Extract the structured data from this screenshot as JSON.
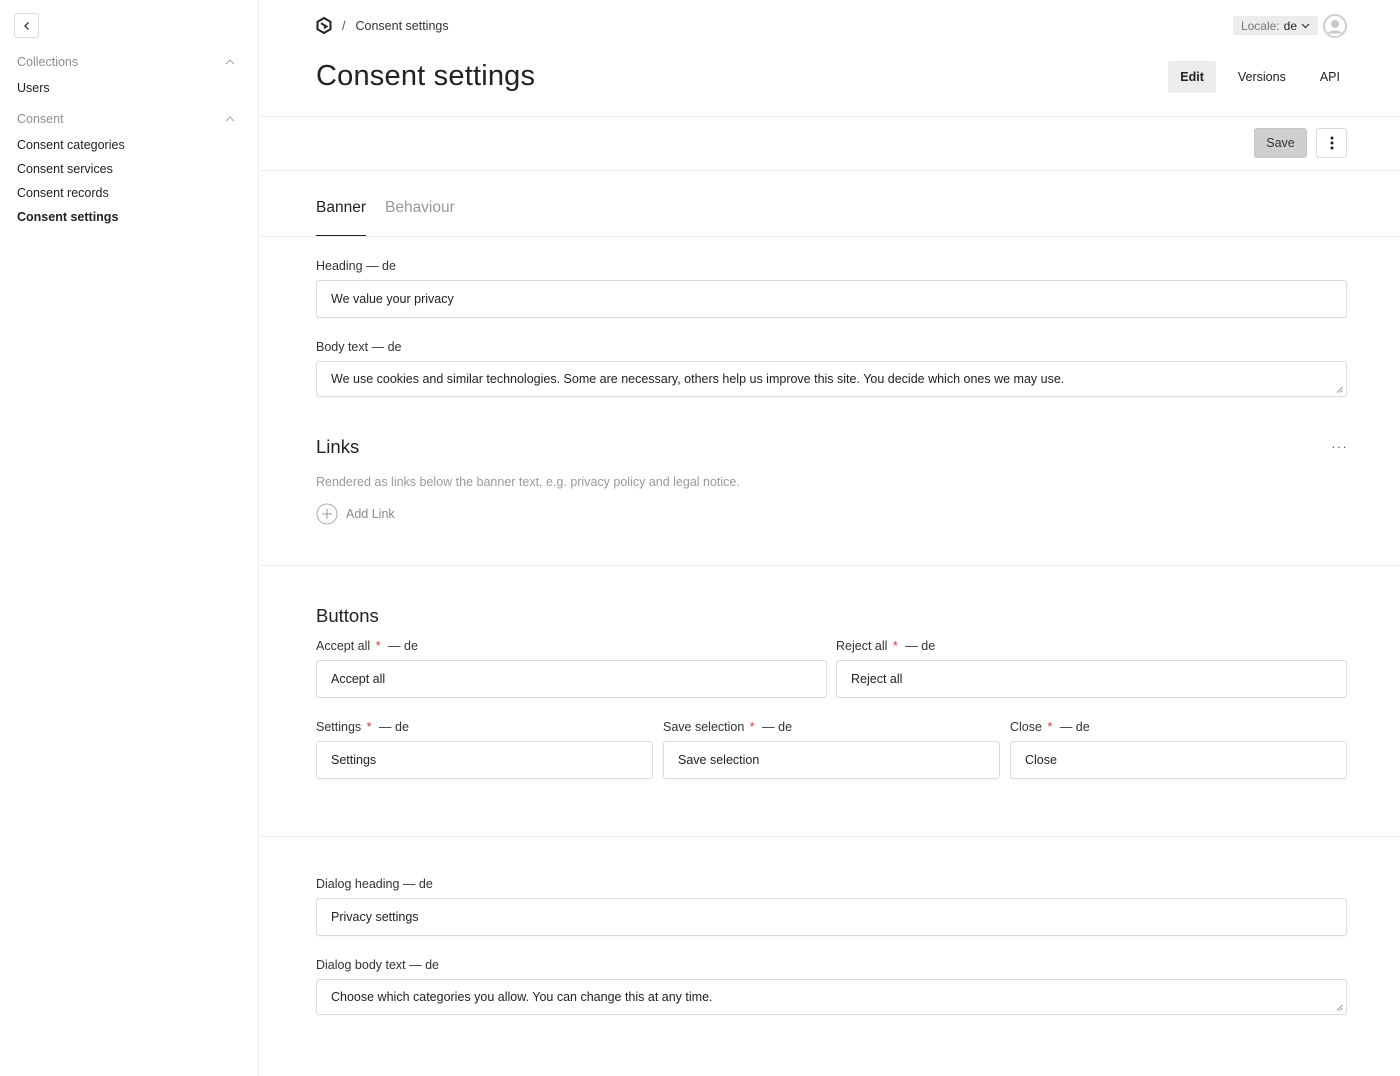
{
  "sidebar": {
    "collapse_icon": "chevron-left-icon",
    "groups": [
      {
        "title": "Collections",
        "items": [
          "Users"
        ]
      },
      {
        "title": "Consent",
        "items": [
          "Consent categories",
          "Consent services",
          "Consent records",
          "Consent settings"
        ]
      }
    ],
    "active_item": "Consent settings"
  },
  "header": {
    "logo_icon": "payload-logo-icon",
    "breadcrumb_separator": "/",
    "breadcrumb_current": "Consent settings",
    "title": "Consent settings",
    "locale_label": "Locale:",
    "locale_value": "de",
    "view_tabs": [
      "Edit",
      "Versions",
      "API"
    ],
    "active_view_tab": "Edit"
  },
  "toolbar": {
    "save_label": "Save"
  },
  "tabs": {
    "items": [
      "Banner",
      "Behaviour"
    ],
    "active": "Banner"
  },
  "banner": {
    "heading": {
      "label": "Heading",
      "locale_suffix": "— de",
      "value": "We value your privacy"
    },
    "body_text": {
      "label": "Body text",
      "locale_suffix": "— de",
      "value": "We use cookies and similar technologies. Some are necessary, others help us improve this site. You decide which ones we may use."
    }
  },
  "links": {
    "title": "Links",
    "menu": "···",
    "description": "Rendered as links below the banner text, e.g. privacy policy and legal notice.",
    "add_label": "Add Link"
  },
  "buttons": {
    "title": "Buttons",
    "required_mark": "*",
    "accept_all": {
      "label": "Accept all",
      "locale_suffix": "— de",
      "value": "Accept all"
    },
    "reject_all": {
      "label": "Reject all",
      "locale_suffix": "— de",
      "value": "Reject all"
    },
    "settings": {
      "label": "Settings",
      "locale_suffix": "— de",
      "value": "Settings"
    },
    "save_selection": {
      "label": "Save selection",
      "locale_suffix": "— de",
      "value": "Save selection"
    },
    "close": {
      "label": "Close",
      "locale_suffix": "— de",
      "value": "Close"
    }
  },
  "dialog": {
    "heading": {
      "label": "Dialog heading",
      "locale_suffix": "— de",
      "value": "Privacy settings"
    },
    "body_text": {
      "label": "Dialog body text",
      "locale_suffix": "— de",
      "value": "Choose which categories you allow. You can change this at any time."
    }
  }
}
